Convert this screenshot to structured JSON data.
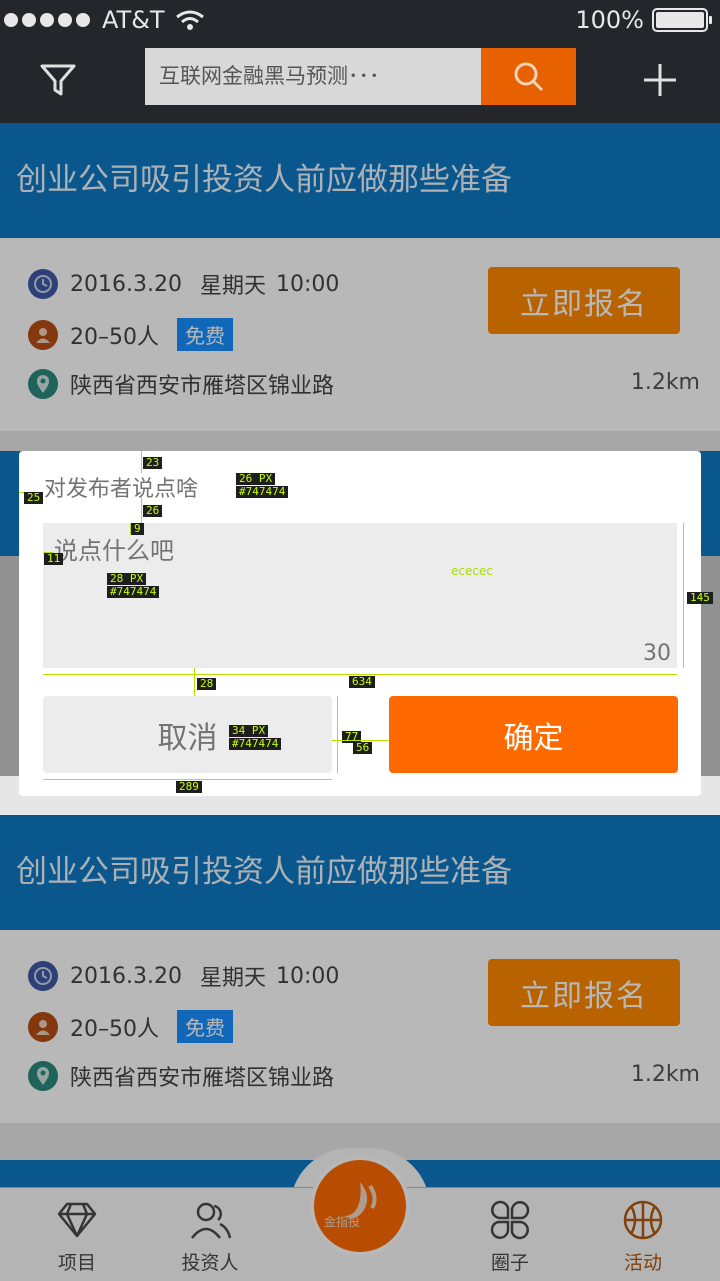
{
  "status_bar": {
    "carrier": "AT&T",
    "battery_label": "100%"
  },
  "nav": {
    "search_placeholder": "互联网金融黑马预测･･･",
    "icons": [
      "filter-icon",
      "search-icon",
      "plus-icon"
    ]
  },
  "events": [
    {
      "title": "创业公司吸引投资人前应做那些准备",
      "date": "2016.3.20",
      "weekday": "星期天",
      "time": "10:00",
      "attendees": "20–50人",
      "price_badge": "免费",
      "address": "陕西省西安市雁塔区锦业路",
      "distance": "1.2km",
      "signup_label": "立即报名"
    },
    {
      "title": "创业公司吸引投资人前应做那些准备",
      "date": "2016.3.20",
      "weekday": "星期天",
      "time": "10:00",
      "attendees": "20–50人",
      "price_badge": "免费",
      "address": "陕西省西安市雁塔区锦业路",
      "distance": "1.2km",
      "signup_label": "立即报名"
    }
  ],
  "dialog": {
    "title": "对发布者说点啥",
    "placeholder": "说点什么吧",
    "counter": "30",
    "cancel_label": "取消",
    "confirm_label": "确定",
    "confirm_color": "#ff6a00",
    "text_color": "#747474",
    "textarea_color": "#ececec"
  },
  "annotations": {
    "title_size": "26 PX",
    "title_color": "#747474",
    "placeholder_size": "28 PX",
    "placeholder_color": "#747474",
    "button_size": "34 PX",
    "button_color": "#747474",
    "textarea_color_label": "ececec",
    "dim_23": "23",
    "dim_25": "25",
    "dim_26": "26",
    "dim_9": "9",
    "dim_11": "11",
    "dim_145": "145",
    "dim_634": "634",
    "dim_28": "28",
    "dim_77": "77",
    "dim_56": "56",
    "dim_289": "289"
  },
  "tabs": [
    {
      "label": "项目",
      "icon": "diamond-icon"
    },
    {
      "label": "投资人",
      "icon": "people-icon"
    },
    {
      "label": "圈子",
      "icon": "clover-icon"
    },
    {
      "label": "活动",
      "icon": "basketball-icon",
      "active": true
    }
  ],
  "center_logo_text": "金指投"
}
